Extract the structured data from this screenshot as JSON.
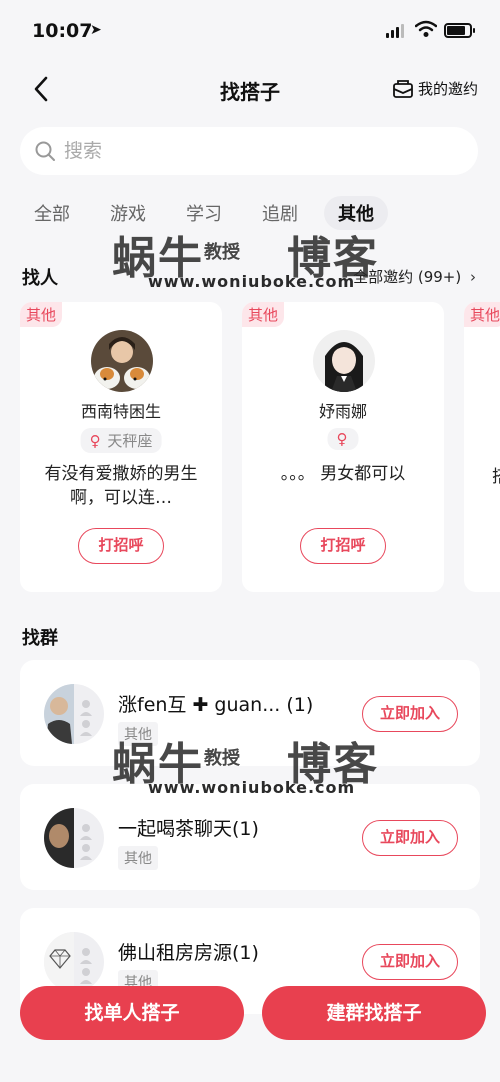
{
  "status_bar": {
    "time": "10:07"
  },
  "nav": {
    "title": "找搭子",
    "my_invites": "我的邀约"
  },
  "search": {
    "placeholder": "搜索"
  },
  "tabs": [
    {
      "label": "全部"
    },
    {
      "label": "游戏"
    },
    {
      "label": "学习"
    },
    {
      "label": "追剧"
    },
    {
      "label": "其他",
      "active": true
    }
  ],
  "watermark": {
    "big_left": "蜗牛",
    "small": "教授",
    "big_right": "博客",
    "url": "www.woniuboke.com"
  },
  "find_people": {
    "title": "找人",
    "all_invites": "全部邀约 (99+)",
    "cards": [
      {
        "tag": "其他",
        "name": "西南特困生",
        "gender": "♀",
        "zodiac": "天秤座",
        "message": "有没有爱撒娇的男生啊，可以连…",
        "greet": "打招呼"
      },
      {
        "tag": "其他",
        "name": "妤雨娜",
        "gender": "♀",
        "zodiac": "",
        "message": "。。。 男女都可以",
        "greet": "打招呼"
      },
      {
        "tag": "其他",
        "message_fragment": "搭"
      }
    ]
  },
  "find_group": {
    "title": "找群",
    "groups": [
      {
        "name": "涨fen互 ✚ guan... (1)",
        "tag": "其他",
        "join": "立即加入"
      },
      {
        "name": "一起喝茶聊天(1)",
        "tag": "其他",
        "join": "立即加入"
      },
      {
        "name": "佛山租房房源(1)",
        "tag": "其他",
        "join": "立即加入"
      }
    ]
  },
  "bottom": {
    "single": "找单人搭子",
    "group": "建群找搭子"
  },
  "colors": {
    "accent": "#e8404f",
    "tag_bg": "#fde6ea",
    "page_bg": "#f6f6f8"
  },
  "icons": [
    "location-arrow-icon",
    "signal-icon",
    "wifi-icon",
    "battery-icon",
    "back-chevron-icon",
    "envelope-icon",
    "search-icon",
    "chevron-right-icon",
    "female-icon",
    "person-placeholder-icon",
    "diamond-icon"
  ]
}
